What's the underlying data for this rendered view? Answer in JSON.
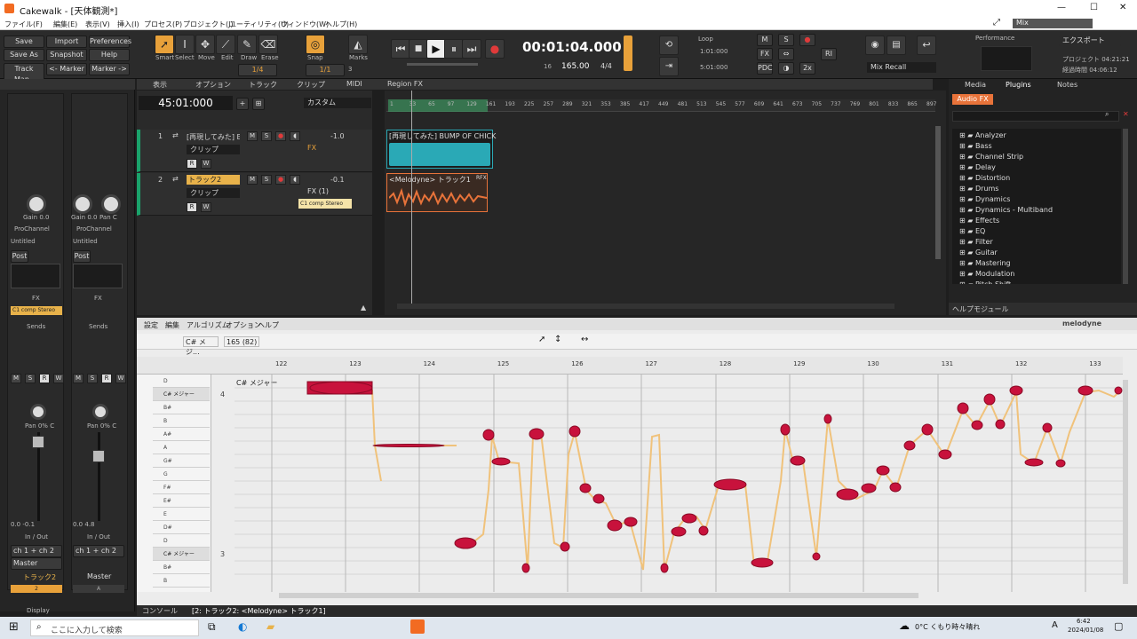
{
  "window": {
    "title": "Cakewalk - [天体観測*]",
    "min": "—",
    "max": "☐",
    "close": "✕"
  },
  "menu": [
    "ファイル(F)",
    "編集(E)",
    "表示(V)",
    "挿入(I)",
    "プロセス(P)",
    "プロジェクト(J)",
    "ユーティリティ(U)",
    "ウィンドウ(W)",
    "ヘルプ(H)"
  ],
  "menu_right": "Mix",
  "control": {
    "left_buttons": [
      "Save",
      "Import",
      "Preferences",
      "Save As",
      "Snapshot",
      "Help",
      "Track Man..",
      "<- Marker",
      "Marker ->"
    ],
    "tools": [
      "Smart",
      "Select",
      "Move",
      "Edit",
      "Draw",
      "Erase"
    ],
    "tool_snap": "Snap",
    "tool_marks": "Marks",
    "snap_value": "1/4",
    "snap_value2": "1/1",
    "snap_num": "3",
    "time": "00:01:04.000",
    "tempo": "165.00",
    "meter": "4/4",
    "tempo_sub1": "16",
    "loop_label": "Loop",
    "loop_start": "1:01:000",
    "loop_end": "5:01:000",
    "mix_buttons": [
      "M",
      "S",
      "●",
      "FX",
      "⇔",
      "RI",
      "PDC",
      "◑",
      "2x"
    ],
    "mix_recall": "Mix Recall",
    "perf_label": "Performance",
    "export_label": "エクスポート",
    "project_time": "プロジェクト 04:21:21",
    "elapsed_time": "経過時間 04:06:12"
  },
  "inspector": {
    "gain_label": "Gain",
    "gain_val": "0.0",
    "gain2_val": "0.0",
    "pan_label": "Pan",
    "pan_val": "C",
    "prochannel": "ProChannel",
    "untitled": "Untitled",
    "post": "Post",
    "fx": "FX",
    "fx_plugin": "C1 comp Stereo",
    "sends": "Sends",
    "pan_pct": "Pan 0% C",
    "vol1_a": "0.0",
    "vol1_b": "-0.1",
    "vol2_a": "0.0",
    "vol2_b": "4.8",
    "inout": "In / Out",
    "input": "ch 1 + ch 2",
    "output": "Master",
    "track_name": "トラック2",
    "master_name": "Master",
    "track_num": "2",
    "master_sub": "A",
    "display": "Display"
  },
  "tracks_toolbar": [
    "表示",
    "オプション",
    "トラック",
    "クリップ",
    "MIDI",
    "Region FX"
  ],
  "tracks": {
    "time": "45:01:000",
    "view_preset": "カスタム",
    "items": [
      {
        "num": "1",
        "name": "[再現してみた] BU",
        "clip": "クリップ",
        "vol": "-1.0",
        "fx": "FX",
        "color": "#2f2f2f"
      },
      {
        "num": "2",
        "name": "トラック2",
        "clip": "クリップ",
        "vol": "-0.1",
        "fx": "FX (1)",
        "color": "#e8b24a",
        "plugin_tip": "C1 comp Stereo"
      }
    ]
  },
  "ruler": [
    "1",
    "33",
    "65",
    "97",
    "129",
    "161",
    "193",
    "225",
    "257",
    "289",
    "321",
    "353",
    "385",
    "417",
    "449",
    "481",
    "513",
    "545",
    "577",
    "609",
    "641",
    "673",
    "705",
    "737",
    "769",
    "801",
    "833",
    "865",
    "897"
  ],
  "clips": [
    {
      "name": "[再現してみた] BUMP OF CHICK"
    },
    {
      "name": "<Melodyne> トラック1",
      "tag": "RFX"
    }
  ],
  "browser": {
    "tabs": [
      "Media",
      "Plugins",
      "Notes"
    ],
    "audio_fx": "Audio FX",
    "items": [
      "Analyzer",
      "Bass",
      "Channel Strip",
      "Delay",
      "Distortion",
      "Drums",
      "Dynamics",
      "Dynamics - Multiband",
      "Effects",
      "EQ",
      "Filter",
      "Guitar",
      "Mastering",
      "Modulation",
      "Pitch Shift"
    ],
    "help_module": "ヘルプモジュール"
  },
  "melodyne": {
    "menu": [
      "設定",
      "編集",
      "アルゴリズム",
      "オプション",
      "ヘルプ"
    ],
    "brand": "melodyne",
    "key": "C# メジ...",
    "tempo": "165 (82)",
    "bars": [
      "122",
      "123",
      "124",
      "125",
      "126",
      "127",
      "128",
      "129",
      "130",
      "131",
      "132",
      "133"
    ],
    "key_label": "C# メジャー",
    "keys": [
      "D",
      "C# メジャー",
      "B#",
      "B",
      "A#",
      "A",
      "G#",
      "G",
      "F#",
      "E#",
      "E",
      "D#",
      "D",
      "C# メジャー",
      "B#",
      "B"
    ],
    "octave_top": "4",
    "octave_bottom": "3"
  },
  "bottom_tabs": [
    "コンソール",
    "[2: トラック2: <Melodyne> トラック1]"
  ],
  "taskbar": {
    "search": "ここに入力して検索",
    "weather": "0°C くもり時々晴れ",
    "clock_time": "6:42",
    "clock_date": "2024/01/08",
    "ime": "A"
  }
}
